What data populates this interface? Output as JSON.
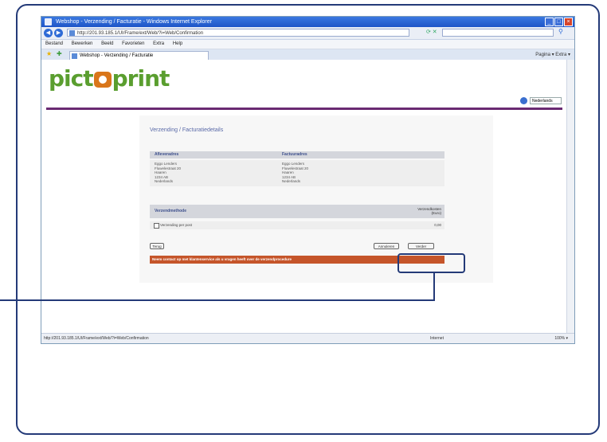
{
  "window": {
    "title": "Webshop - Verzending / Facturatie - Windows Internet Explorer",
    "url": "http://201.93.185.1/UI/Frame/ext/Web/?i=Web/Confirmation"
  },
  "browser": {
    "menu": [
      "Bestand",
      "Bewerken",
      "Beeld",
      "Favorieten",
      "Extra",
      "Help"
    ],
    "tab_label": "Webshop - Verzending / Facturatie",
    "tools": "Pagina ▾  Extra ▾"
  },
  "site": {
    "logo_text_before": "pict",
    "logo_text_after": "print",
    "language": "Nederlands"
  },
  "content": {
    "title": "Verzending / Facturatiedetails",
    "delivery_header": "Afleveradres",
    "invoice_header": "Factuuradres",
    "delivery_lines": [
      "Eggo Lenders",
      "Fluwelestraat 20",
      "Haaren",
      "1234 AB",
      "Nederlands"
    ],
    "invoice_lines": [
      "Eggo Lenders",
      "Fluwelestraat 20",
      "Haaren",
      "1234 AB",
      "Nederlands"
    ],
    "shipping_header": "Verzendmethode",
    "shipping_cost_header_1": "Verzendkosten",
    "shipping_cost_header_2": "(Euro)",
    "shipping_option": "Verzending per post",
    "shipping_cost": "0,00",
    "back_button": "Terug",
    "cancel_button": "Annuleren",
    "next_button": "Verder",
    "notice": "Neem contact op met klantenservice als u vragen heeft over de verzendprocedure"
  },
  "statusbar": {
    "url": "http://201.93.185.1/UI/Frame/ext/Web/?i=Web/Confirmation",
    "zone": "Internet",
    "zoom": "100% ▾"
  }
}
